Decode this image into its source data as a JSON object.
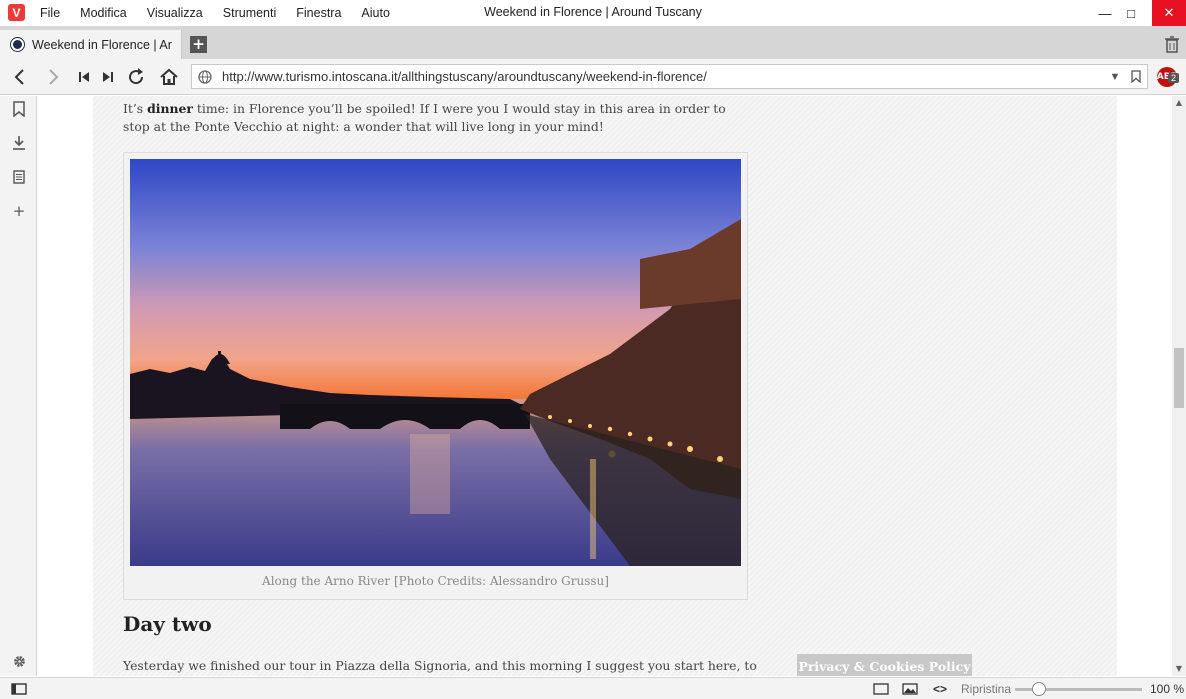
{
  "window": {
    "title": "Weekend in Florence | Around Tuscany",
    "minimize": "—",
    "maximize": "□",
    "close": "✕"
  },
  "menu": {
    "items": [
      "File",
      "Modifica",
      "Visualizza",
      "Strumenti",
      "Finestra",
      "Aiuto"
    ]
  },
  "tabs": [
    {
      "title": "Weekend in Florence | Around Tuscany"
    }
  ],
  "address": {
    "url": "http://www.turismo.intoscana.it/allthingstuscany/aroundtuscany/weekend-in-florence/"
  },
  "extensions": {
    "adblock_label": "ABP",
    "adblock_count": "2"
  },
  "page": {
    "intro_prefix": "It’s ",
    "intro_bold": "dinner",
    "intro_rest": " time: in Florence you’ll be spoiled! If I were you I would stay in this area in order to stop at the Ponte Vecchio at night: a wonder that will live long in your mind!",
    "figure_caption": "Along the Arno River [Photo Credits: Alessandro Grussu]",
    "heading": "Day two",
    "para2": "Yesterday we finished our tour in Piazza della Signoria, and this morning I suggest you start here, to be",
    "cookie_banner": "Privacy & Cookies Policy"
  },
  "status": {
    "reset_label": "Ripristina",
    "zoom_value": "100 %",
    "zoom_fraction": 0.2
  },
  "colors": {
    "vivaldi_red": "#ef3939",
    "close_red": "#e81123"
  }
}
